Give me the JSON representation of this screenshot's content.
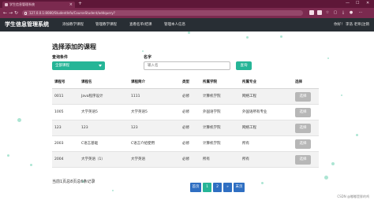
{
  "browser": {
    "tab_title": "学生信息管理系统",
    "url": "127.0.0.1:8080/StudentInfo/CourseStudent/addquery?",
    "window_controls": [
      "—",
      "☐",
      "✕"
    ]
  },
  "header": {
    "title": "学生信息管理系统",
    "nav": [
      {
        "label": "添加教学课程"
      },
      {
        "label": "管理教学课程"
      },
      {
        "label": "查看名单/结课"
      },
      {
        "label": "管理本人信息"
      }
    ],
    "user": "你好！ 李浩 老师|注销"
  },
  "page": {
    "heading": "选择添加的课程",
    "filter_label": "查询条件",
    "filter_value": "全部课程",
    "name_label": "名字",
    "name_placeholder": "输入名",
    "search_button": "查询"
  },
  "table": {
    "columns": [
      "课程号",
      "课程名",
      "课程简介",
      "类型",
      "所属学院",
      "所属专业",
      "选择"
    ],
    "rows": [
      {
        "id": "0011",
        "name": "Java程序设计",
        "intro": "1111",
        "type": "必修",
        "college": "计算机学院",
        "major": "网络工程",
        "action": "选择"
      },
      {
        "id": "1005",
        "name": "大学英语5",
        "intro": "大学英语5",
        "type": "必修",
        "college": "外国语学院",
        "major": "外国语所有专业",
        "action": "选择"
      },
      {
        "id": "123",
        "name": "123",
        "intro": "123",
        "type": "必修",
        "college": "计算机学院",
        "major": "网络工程",
        "action": "选择"
      },
      {
        "id": "2003",
        "name": "C语言基础",
        "intro": "C语言介绍使用",
        "type": "必修",
        "college": "计算机学院",
        "major": "所有",
        "action": "选择"
      },
      {
        "id": "2004",
        "name": "大学英语（1）",
        "intro": "大学英语",
        "type": "必修",
        "college": "所有",
        "major": "所有",
        "action": "选择"
      }
    ]
  },
  "footer": {
    "summary": "当前1页总8页总6条记录",
    "pagination": [
      "首页",
      "1",
      "2",
      "»",
      "末页"
    ],
    "watermark": "CSDN @嘟嘟是胖的鸡"
  },
  "colors": {
    "accent": "#26b597",
    "header_bg": "#282e34",
    "browser_bg": "#7b2a4f",
    "pager_blue": "#2f6fc2"
  }
}
